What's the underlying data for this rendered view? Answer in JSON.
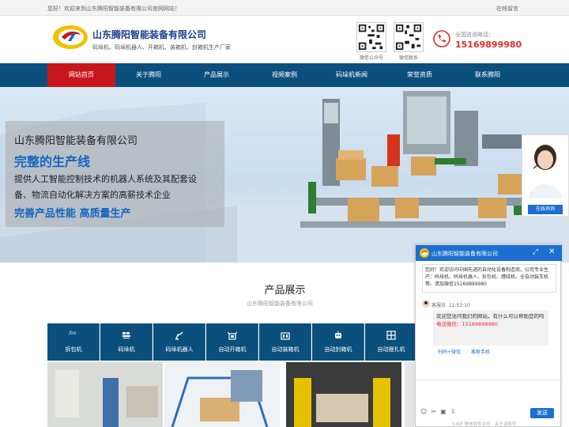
{
  "topbar": {
    "welcome": "您好！欢迎来到山东腾阳智能装备有限公司官网网站！",
    "message_link": "在线留言"
  },
  "header": {
    "company": "山东腾阳智能装备有限公司",
    "slogan": "码垛机、码垛机器人、开箱机、装箱机、封箱机生产厂家",
    "qr1_label": "微信公众号",
    "qr2_label": "微信联系",
    "phone_label": "全国咨询电话：",
    "phone": "15169899980"
  },
  "nav": {
    "items": [
      {
        "label": "网站首页"
      },
      {
        "label": "关于腾阳"
      },
      {
        "label": "产品展示"
      },
      {
        "label": "视频案例"
      },
      {
        "label": "码垛机新闻"
      },
      {
        "label": "荣誉资质"
      },
      {
        "label": "联系腾阳"
      }
    ]
  },
  "banner": {
    "company": "山东腾阳智能装备有限公司",
    "headline": "完整的生产线",
    "line1": "提供人工智能控制技术的机器人系统及其配套设",
    "line2": "备、物流自动化解决方案的高薪技术企业",
    "tagline": "完善产品性能 高质量生产"
  },
  "service_float": {
    "button": "在线询询"
  },
  "products": {
    "title": "产品展示",
    "subtitle": "山东腾阳智能装备有限公司",
    "categories": [
      {
        "label": "拆包机",
        "icon": "broken-image-icon",
        "alt": "/bo"
      },
      {
        "label": "码垛机",
        "icon": "palletizer-icon"
      },
      {
        "label": "码垛机器人",
        "icon": "robot-arm-icon"
      },
      {
        "label": "自动开箱机",
        "icon": "box-open-icon"
      },
      {
        "label": "自动装箱机",
        "icon": "box-pack-icon"
      },
      {
        "label": "自动封箱机",
        "icon": "robot-head-icon"
      },
      {
        "label": "自动捆扎机",
        "icon": "strap-icon"
      }
    ]
  },
  "chat": {
    "title": "山东腾阳智能装备有限公司",
    "intro": "您好！欢迎访问中国先进的自动化设备制造商，公司专业生产：码垛机、码垛机器人、拆包机、缠绕机、全自动装车机等。请加微信15169899980",
    "agent": "客服苏",
    "time": "11:53:10",
    "message": "欢迎您访问我们的网站，有什么可以帮助您的吗",
    "wechat": "电话微信：15169899980",
    "quick1": "扫码+微信",
    "quick2": "客联手机",
    "send": "发送",
    "footer": "53KF 微信软件支持 · 关于该账号"
  }
}
